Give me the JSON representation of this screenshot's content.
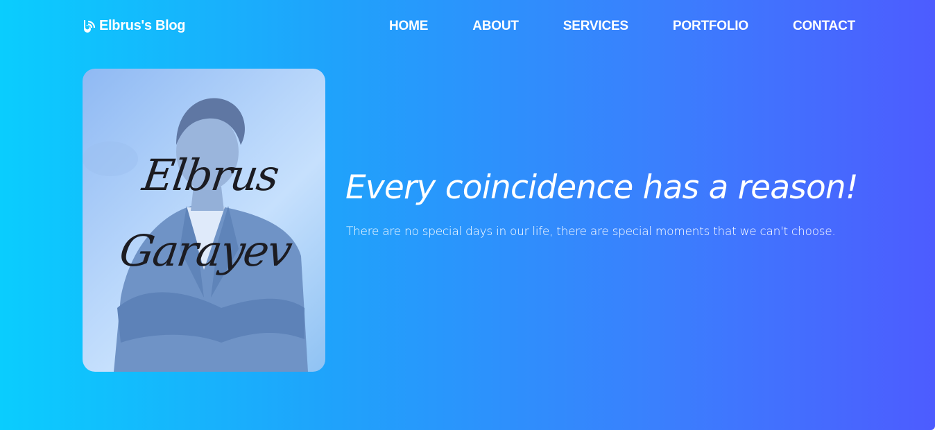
{
  "brand": {
    "name": "Elbrus's Blog",
    "icon": "blog-logo-icon"
  },
  "nav": {
    "items": [
      {
        "label": "HOME"
      },
      {
        "label": "ABOUT"
      },
      {
        "label": "SERVICES"
      },
      {
        "label": "PORTFOLIO"
      },
      {
        "label": "CONTACT"
      }
    ]
  },
  "hero": {
    "photo": {
      "signature_first": "Elbrus",
      "signature_last": "Garayev"
    },
    "headline": "Every coincidence has a reason!",
    "subline": "There are no special days in our life, there are special moments that we can't choose."
  },
  "colors": {
    "gradient_start": "#0acdfe",
    "gradient_end": "#4d5cff",
    "text": "#ffffff"
  }
}
